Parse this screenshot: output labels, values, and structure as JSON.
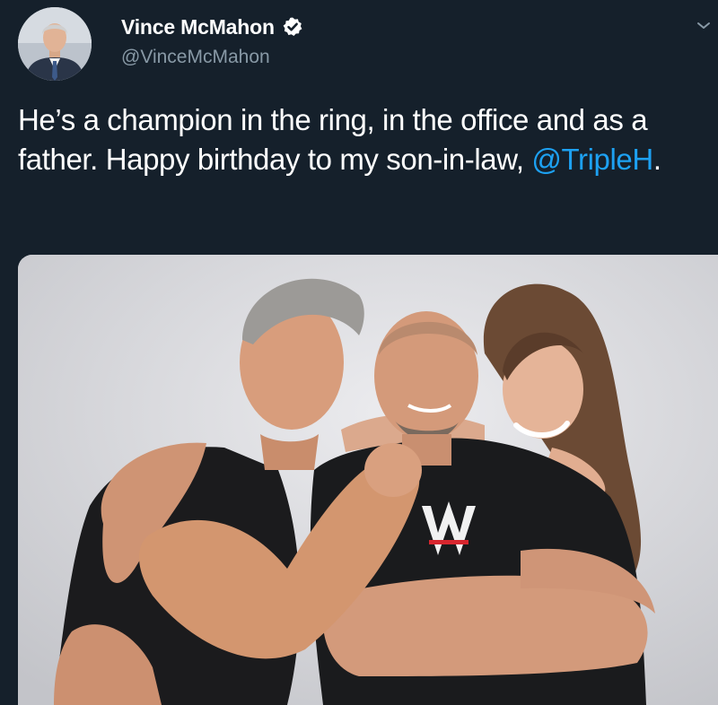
{
  "tweet": {
    "author": {
      "display_name": "Vince McMahon",
      "handle": "@VinceMcMahon",
      "verified": true
    },
    "text_before": "He’s a champion in the ring, in the office and as a father. Happy birthday to my son-in-law, ",
    "mention": "@TripleH",
    "text_after": ".",
    "media": {
      "type": "photo",
      "wordmark": "W"
    }
  },
  "colors": {
    "background": "#15202b",
    "link": "#1da1f2",
    "secondary_text": "#8899a6",
    "verified_badge": "#ffffff"
  },
  "icons": [
    "verified-badge-icon",
    "chevron-down-icon"
  ]
}
